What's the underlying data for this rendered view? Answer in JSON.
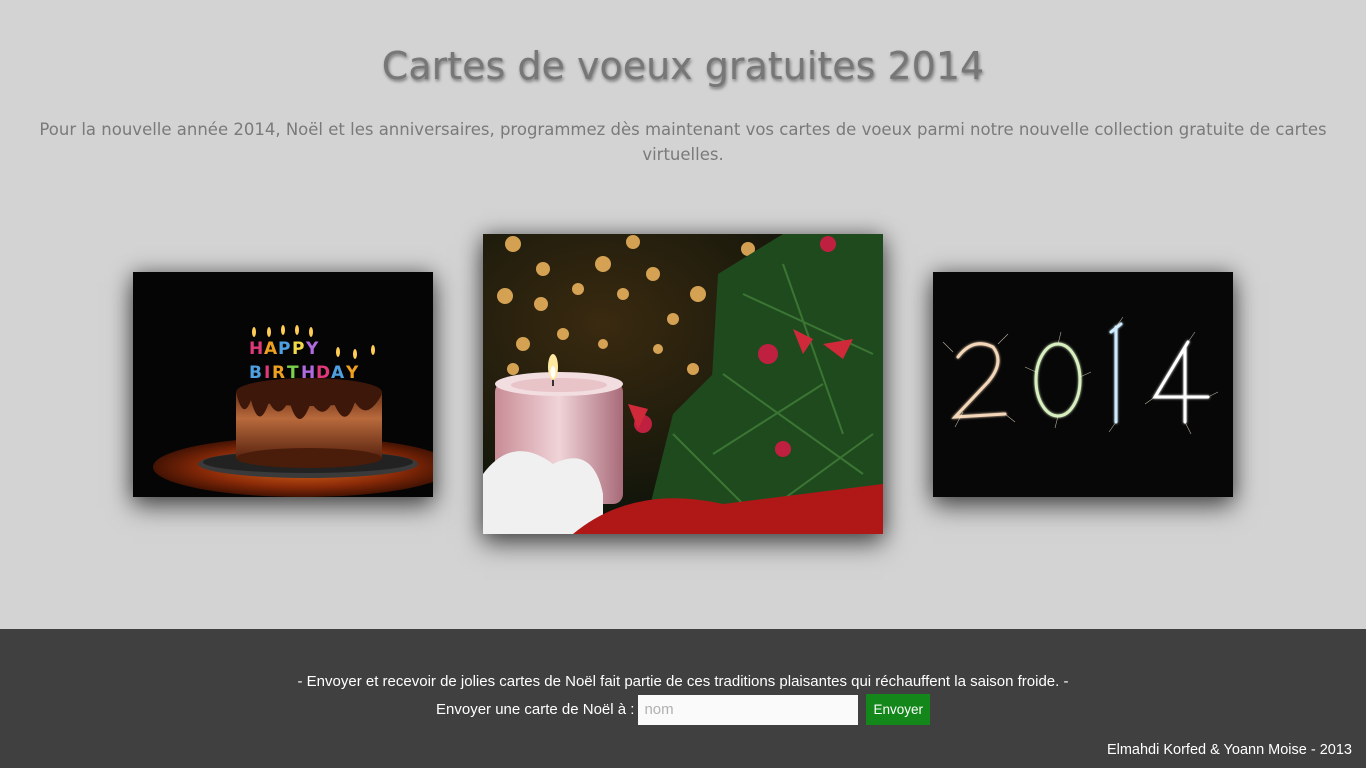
{
  "header": {
    "title": "Cartes de voeux gratuites 2014",
    "intro": "Pour la nouvelle année 2014, Noël et les anniversaires, programmez dès maintenant vos cartes de voeux parmi notre nouvelle collection gratuite de cartes virtuelles."
  },
  "gallery": {
    "cards": [
      {
        "id": "birthday",
        "image_text": "HAPPY BIRTHDAY"
      },
      {
        "id": "christmas"
      },
      {
        "id": "new-year",
        "image_text": "2014"
      }
    ]
  },
  "footer": {
    "tagline": "- Envoyer et recevoir de jolies cartes de Noël fait partie de ces traditions plaisantes qui réchauffent la saison froide. -",
    "send_label": "Envoyer une carte de Noël à :",
    "name_placeholder": "nom",
    "name_value": "",
    "send_button": "Envoyer",
    "credits": "Elmahdi Korfed & Yoann Moise - 2013"
  },
  "colors": {
    "page_background": "#d3d3d3",
    "footer_background": "#404040",
    "button_background": "#13871a"
  }
}
